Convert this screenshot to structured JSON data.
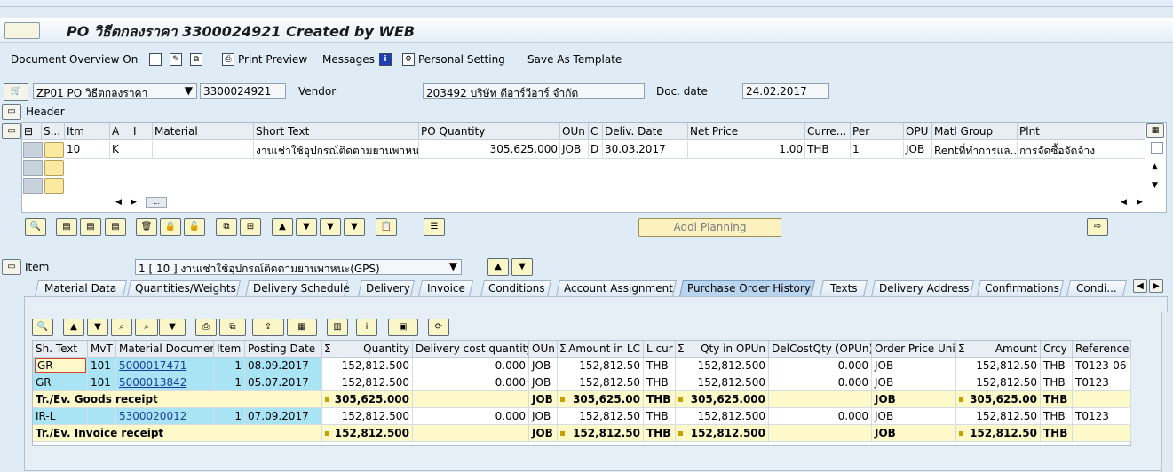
{
  "window": {
    "title": "PO วิธีตกลงราคา 3300024921 Created by WEB"
  },
  "toolbar": {
    "doc_overview": "Document Overview On",
    "print_preview": "Print Preview",
    "messages": "Messages",
    "personal_setting": "Personal Setting",
    "save_template": "Save As Template"
  },
  "headerbar": {
    "doc_type": "ZP01 PO วิธีตกลงราคา",
    "po_number": "3300024921",
    "vendor_label": "Vendor",
    "vendor_value": "203492 บริษัท ดีอาร์วีอาร์ จำกัด",
    "doc_date_label": "Doc. date",
    "doc_date_value": "24.02.2017",
    "header_label": "Header"
  },
  "items_table": {
    "columns": [
      "S...",
      "Itm",
      "A",
      "I",
      "Material",
      "Short Text",
      "PO Quantity",
      "OUn",
      "C",
      "Deliv. Date",
      "Net Price",
      "Curre...",
      "Per",
      "OPU",
      "Matl Group",
      "Plnt"
    ],
    "rows": [
      {
        "itm": "10",
        "a": "K",
        "i": "",
        "material": "",
        "short_text": "งานเช่าใช้อุปกรณ์ติดตามยานพาหน...",
        "po_qty": "305,625.000",
        "oun": "JOB",
        "c": "D",
        "deliv_date": "30.03.2017",
        "net_price": "1.00",
        "currency": "THB",
        "per": "1",
        "opu": "JOB",
        "matl_group": "Rentที่ทำการแล...",
        "plnt": "การจัดซื้อจัดจ้าง"
      }
    ],
    "addl_planning": "Addl Planning"
  },
  "item_section": {
    "label": "Item",
    "selected": "1 [ 10 ] งานเช่าใช้อุปกรณ์ติดตามยานพาหนะ(GPS)"
  },
  "tabs": [
    "Material Data",
    "Quantities/Weights",
    "Delivery Schedule",
    "Delivery",
    "Invoice",
    "Conditions",
    "Account Assignment",
    "Purchase Order History",
    "Texts",
    "Delivery Address",
    "Confirmations",
    "Condi..."
  ],
  "active_tab": "Purchase Order History",
  "history": {
    "columns": [
      "Sh. Text",
      "MvT",
      "Material Document",
      "Item",
      "Posting Date",
      "Quantity",
      "Delivery cost quantity",
      "OUn",
      "Amount in LC",
      "L.cur",
      "Qty in OPUn",
      "DelCostQty (OPUn)",
      "Order Price Unit",
      "Amount",
      "Crcy",
      "Reference"
    ],
    "rows": [
      {
        "type": "data",
        "sh": "GR",
        "mvt": "101",
        "doc": "5000017471",
        "item": "1",
        "date": "08.09.2017",
        "qty": "152,812.500",
        "dcq": "0.000",
        "oun": "JOB",
        "amt_lc": "152,812.50",
        "lcur": "THB",
        "qty_opun": "152,812.500",
        "dcq_opun": "0.000",
        "opu": "JOB",
        "amount": "152,812.50",
        "crcy": "THB",
        "ref": "T0123-06"
      },
      {
        "type": "data",
        "sh": "GR",
        "mvt": "101",
        "doc": "5000013842",
        "item": "1",
        "date": "05.07.2017",
        "qty": "152,812.500",
        "dcq": "0.000",
        "oun": "JOB",
        "amt_lc": "152,812.50",
        "lcur": "THB",
        "qty_opun": "152,812.500",
        "dcq_opun": "0.000",
        "opu": "JOB",
        "amount": "152,812.50",
        "crcy": "THB",
        "ref": "T0123"
      },
      {
        "type": "sum",
        "sh": "Tr./Ev. Goods receipt",
        "qty": "305,625.000",
        "oun": "JOB",
        "amt_lc": "305,625.00",
        "lcur": "THB",
        "qty_opun": "305,625.000",
        "opu": "JOB",
        "amount": "305,625.00",
        "crcy": "THB"
      },
      {
        "type": "data",
        "sh": "IR-L",
        "mvt": "",
        "doc": "5300020012",
        "item": "1",
        "date": "07.09.2017",
        "qty": "152,812.500",
        "dcq": "0.000",
        "oun": "JOB",
        "amt_lc": "152,812.50",
        "lcur": "THB",
        "qty_opun": "152,812.500",
        "dcq_opun": "0.000",
        "opu": "JOB",
        "amount": "152,812.50",
        "crcy": "THB",
        "ref": "T0123"
      },
      {
        "type": "sum",
        "sh": "Tr./Ev. Invoice receipt",
        "qty": "152,812.500",
        "oun": "JOB",
        "amt_lc": "152,812.50",
        "lcur": "THB",
        "qty_opun": "152,812.500",
        "opu": "JOB",
        "amount": "152,812.50",
        "crcy": "THB"
      }
    ]
  },
  "colors": {
    "accent": "#b8d4ee",
    "sum_row": "#fef9c8",
    "highlight": "#a8e4f4",
    "link": "#1a3c9a"
  }
}
